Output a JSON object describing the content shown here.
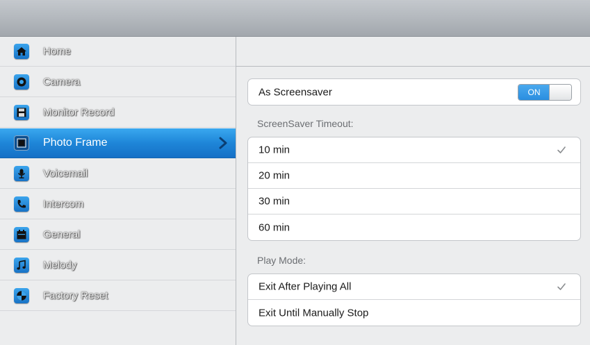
{
  "sidebar": {
    "items": [
      {
        "label": "Home",
        "icon": "home-icon"
      },
      {
        "label": "Camera",
        "icon": "camera-icon"
      },
      {
        "label": "Monitor Record",
        "icon": "floppy-disk-icon"
      },
      {
        "label": "Photo Frame",
        "icon": "photo-frame-icon"
      },
      {
        "label": "Voicemail",
        "icon": "microphone-icon"
      },
      {
        "label": "Intercom",
        "icon": "phone-icon"
      },
      {
        "label": "General",
        "icon": "calendar-icon"
      },
      {
        "label": "Melody",
        "icon": "music-note-icon"
      },
      {
        "label": "Factory Reset",
        "icon": "reset-icon"
      }
    ],
    "active_index": 3
  },
  "settings": {
    "screensaver": {
      "label": "As Screensaver",
      "toggle_state": "ON"
    },
    "timeout": {
      "section_label": "ScreenSaver Timeout:",
      "options": [
        "10 min",
        "20 min",
        "30 min",
        "60 min"
      ],
      "selected_index": 0
    },
    "play_mode": {
      "section_label": "Play Mode:",
      "options": [
        "Exit After Playing All",
        "Exit Until Manually Stop"
      ],
      "selected_index": 0
    }
  },
  "colors": {
    "accent": "#1e86d8",
    "toggle_on": "#2a8ee0"
  }
}
